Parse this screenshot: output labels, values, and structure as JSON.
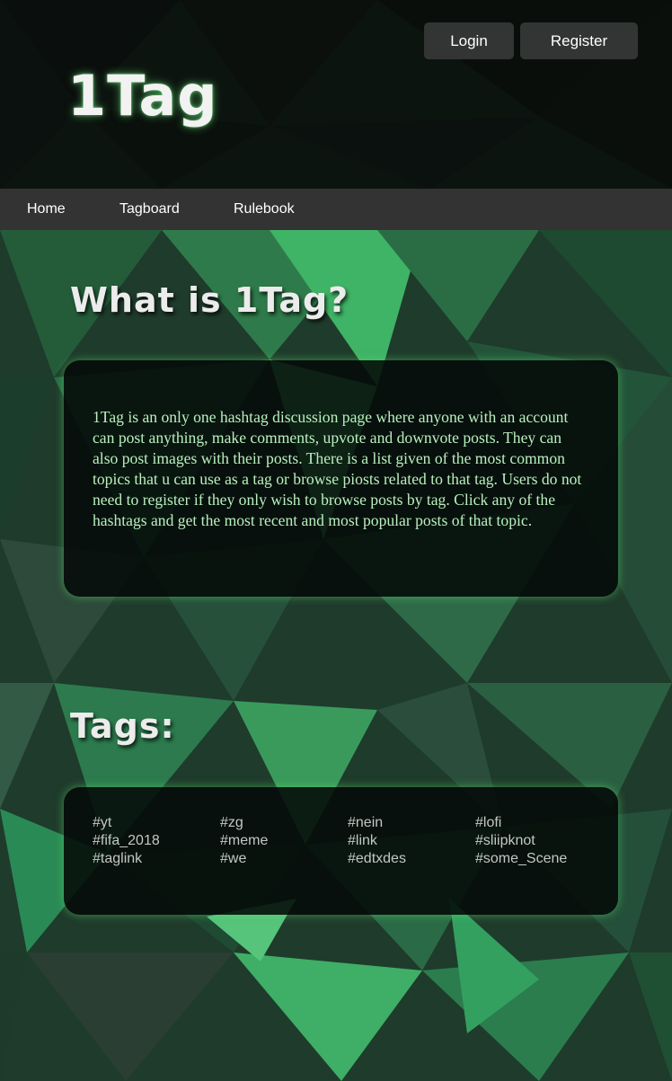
{
  "header": {
    "logo": "1Tag",
    "login_label": "Login",
    "register_label": "Register"
  },
  "nav": {
    "items": [
      {
        "label": "Home"
      },
      {
        "label": "Tagboard"
      },
      {
        "label": "Rulebook"
      }
    ]
  },
  "about": {
    "heading": "What is 1Tag?",
    "text": "1Tag is an only one hashtag discussion page where anyone with an account can post anything, make comments, upvote and downvote posts. They can also post images with their posts. There is a list given of the most common topics that u can use as a tag or browse piosts related to that tag. Users do not need to register if they only wish to browse posts by tag. Click any of the hashtags and get the most recent and most popular posts of that topic."
  },
  "tags": {
    "heading": "Tags:",
    "items": [
      "#yt",
      "#zg",
      "#nein",
      "#lofi",
      "#fifa_2018",
      "#meme",
      "#link",
      "#sliipknot",
      "#taglink",
      "#we",
      "#edtxdes",
      "#some_Scene"
    ]
  },
  "colors": {
    "header_bg": "#0b0f0d",
    "nav_bg": "#333333",
    "button_bg": "#333434",
    "panel_text": "#b9f0be",
    "tag_text": "#c4c8c4",
    "accent_glow": "#5adc6e"
  }
}
